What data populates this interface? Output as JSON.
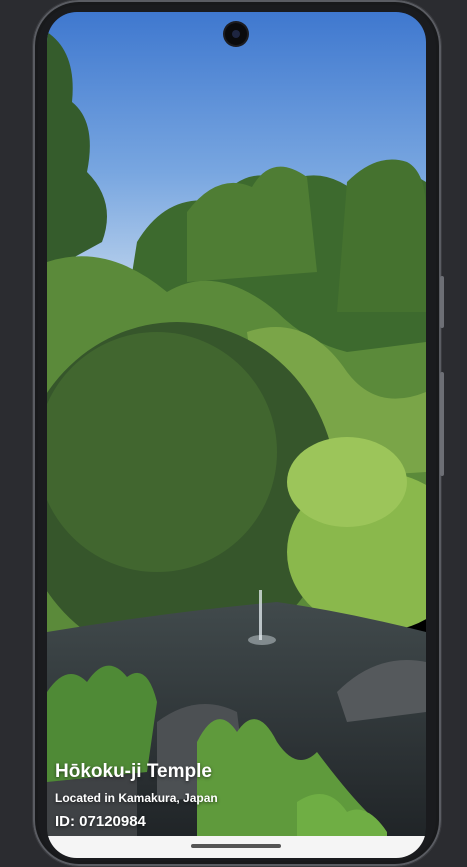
{
  "place": {
    "title": "Hōkoku-ji Temple",
    "location": "Located in Kamakura, Japan",
    "id_label": "ID: 07120984"
  },
  "photo": {
    "subject": "garden-with-pond-and-forest"
  },
  "system": {
    "gesture_bar": "home-gesture-handle"
  }
}
